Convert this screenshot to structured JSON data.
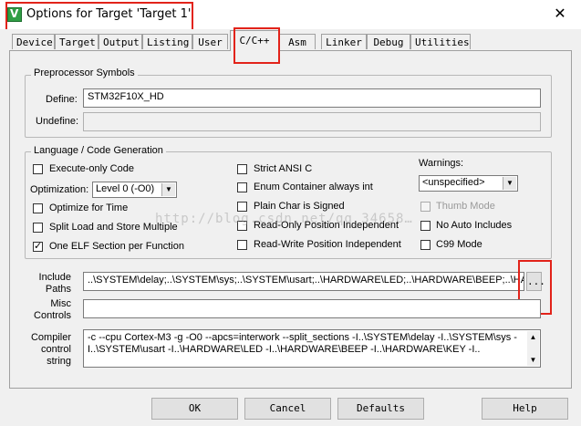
{
  "window": {
    "title": "Options for Target 'Target 1'",
    "close_glyph": "✕"
  },
  "tabs": [
    "Device",
    "Target",
    "Output",
    "Listing",
    "User",
    "C/C++",
    "Asm",
    "Linker",
    "Debug",
    "Utilities"
  ],
  "active_tab": "C/C++",
  "preprocessor": {
    "group_title": "Preprocessor Symbols",
    "define_label": "Define:",
    "define_value": "STM32F10X_HD",
    "undefine_label": "Undefine:",
    "undefine_value": ""
  },
  "language": {
    "group_title": "Language / Code Generation",
    "execute_only": "Execute-only Code",
    "optimization_label": "Optimization:",
    "optimization_value": "Level 0 (-O0)",
    "optimize_time": "Optimize for Time",
    "split_load": "Split Load and Store Multiple",
    "one_elf": "One ELF Section per Function",
    "strict_ansi": "Strict ANSI C",
    "enum_container": "Enum Container always int",
    "plain_char": "Plain Char is Signed",
    "ro_pi": "Read-Only Position Independent",
    "rw_pi": "Read-Write Position Independent",
    "warnings_label": "Warnings:",
    "warnings_value": "<unspecified>",
    "thumb_mode": "Thumb Mode",
    "no_auto_includes": "No Auto Includes",
    "c99_mode": "C99 Mode",
    "checked": {
      "one_elf": true
    }
  },
  "include": {
    "label_line1": "Include",
    "label_line2": "Paths",
    "value": "..\\SYSTEM\\delay;..\\SYSTEM\\sys;..\\SYSTEM\\usart;..\\HARDWARE\\LED;..\\HARDWARE\\BEEP;..\\HARDWARE\\KEY",
    "browse_label": "..."
  },
  "misc": {
    "label_line1": "Misc",
    "label_line2": "Controls",
    "value": ""
  },
  "compiler": {
    "label_line1": "Compiler",
    "label_line2": "control",
    "label_line3": "string",
    "value": "-c --cpu Cortex-M3 -g -O0 --apcs=interwork --split_sections -I..\\SYSTEM\\delay -I..\\SYSTEM\\sys -I..\\SYSTEM\\usart -I..\\HARDWARE\\LED -I..\\HARDWARE\\BEEP -I..\\HARDWARE\\KEY -I.."
  },
  "watermark": "http://blog.csdn.net/qq_34658…",
  "buttons": {
    "ok": "OK",
    "cancel": "Cancel",
    "defaults": "Defaults",
    "help": "Help"
  },
  "colors": {
    "highlight_red": "#e2231a"
  }
}
